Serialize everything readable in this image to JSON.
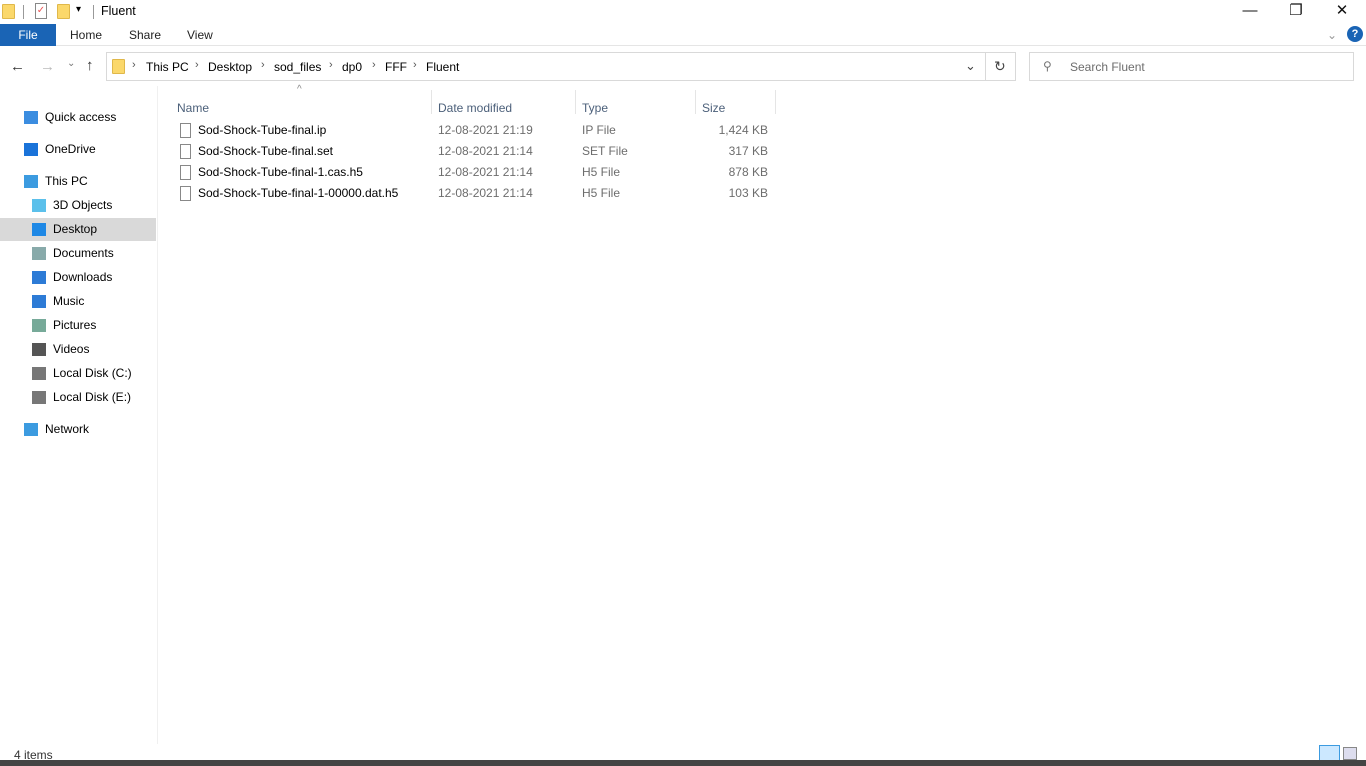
{
  "window": {
    "title": "Fluent"
  },
  "ribbon": {
    "tabs": [
      "File",
      "Home",
      "Share",
      "View"
    ]
  },
  "address": {
    "crumbs": [
      "This PC",
      "Desktop",
      "sod_files",
      "dp0",
      "FFF",
      "Fluent"
    ]
  },
  "search": {
    "placeholder": "Search Fluent"
  },
  "sidebar": {
    "items": [
      {
        "label": "Quick access",
        "icon": "star-icon",
        "indent": 0
      },
      {
        "label": "OneDrive",
        "icon": "cloud-icon",
        "indent": 0
      },
      {
        "label": "This PC",
        "icon": "computer-icon",
        "indent": 0
      },
      {
        "label": "3D Objects",
        "icon": "cube-icon",
        "indent": 1
      },
      {
        "label": "Desktop",
        "icon": "desktop-icon",
        "indent": 1,
        "selected": true
      },
      {
        "label": "Documents",
        "icon": "documents-icon",
        "indent": 1
      },
      {
        "label": "Downloads",
        "icon": "download-icon",
        "indent": 1
      },
      {
        "label": "Music",
        "icon": "music-icon",
        "indent": 1
      },
      {
        "label": "Pictures",
        "icon": "pictures-icon",
        "indent": 1
      },
      {
        "label": "Videos",
        "icon": "videos-icon",
        "indent": 1
      },
      {
        "label": "Local Disk (C:)",
        "icon": "drive-icon",
        "indent": 1
      },
      {
        "label": "Local Disk (E:)",
        "icon": "drive-icon",
        "indent": 1
      },
      {
        "label": "Network",
        "icon": "network-icon",
        "indent": 0
      }
    ]
  },
  "columns": {
    "name": "Name",
    "date": "Date modified",
    "type": "Type",
    "size": "Size"
  },
  "files": [
    {
      "name": "Sod-Shock-Tube-final.ip",
      "date": "12-08-2021 21:19",
      "type": "IP File",
      "size": "1,424 KB"
    },
    {
      "name": "Sod-Shock-Tube-final.set",
      "date": "12-08-2021 21:14",
      "type": "SET File",
      "size": "317 KB"
    },
    {
      "name": "Sod-Shock-Tube-final-1.cas.h5",
      "date": "12-08-2021 21:14",
      "type": "H5 File",
      "size": "878 KB"
    },
    {
      "name": "Sod-Shock-Tube-final-1-00000.dat.h5",
      "date": "12-08-2021 21:14",
      "type": "H5 File",
      "size": "103 KB"
    }
  ],
  "status": {
    "count": "4 items"
  },
  "colors": {
    "accent": "#1a64b5",
    "selected": "#d9d9d9"
  }
}
